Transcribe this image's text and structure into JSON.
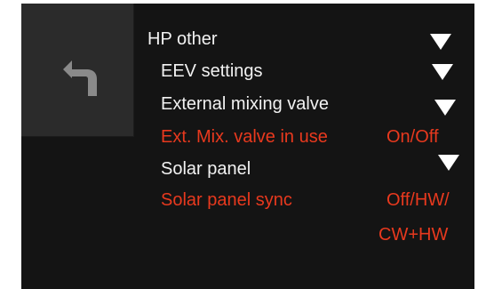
{
  "back": {
    "icon": "back-arrow-icon"
  },
  "menu": {
    "items": [
      {
        "label": "HP other",
        "icon": "dropdown-triangle-icon"
      },
      {
        "label": "EEV settings",
        "icon": "dropdown-triangle-icon"
      },
      {
        "label": "External mixing valve",
        "icon": "dropdown-triangle-icon"
      },
      {
        "label": "Ext. Mix. valve in use",
        "value": "On/Off"
      },
      {
        "label": "Solar panel",
        "icon": "dropdown-triangle-icon"
      },
      {
        "label": "Solar panel sync",
        "value_line1": "Off/HW/",
        "value_line2": "CW+HW"
      }
    ]
  },
  "colors": {
    "background": "#141414",
    "back_panel": "#2b2b2b",
    "text": "#f2f2f2",
    "accent": "#e8391e",
    "icon_gray": "#8a8a8a"
  }
}
